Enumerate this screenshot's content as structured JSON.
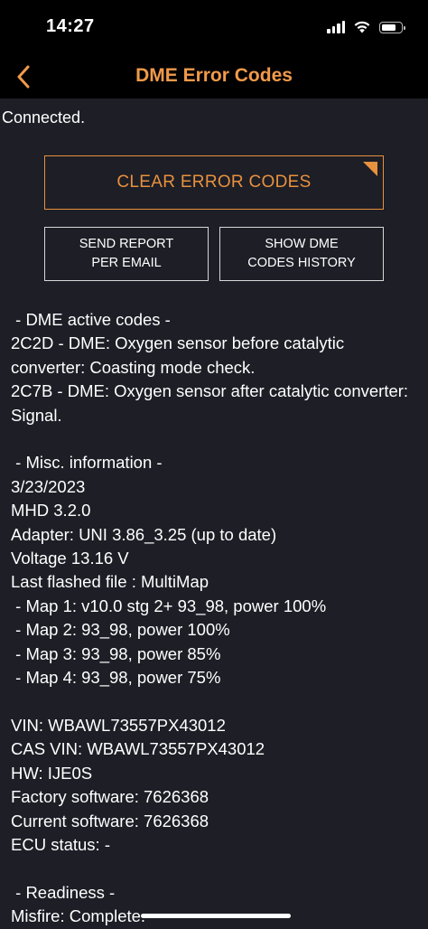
{
  "status_bar": {
    "time": "14:27",
    "signal_bars": 4,
    "battery_level": 0.75
  },
  "nav": {
    "title": "DME Error Codes",
    "back_icon": "chevron-left-icon",
    "accent_color": "#f19a4a"
  },
  "connection": {
    "status": "Connected."
  },
  "buttons": {
    "clear_codes": "CLEAR ERROR CODES",
    "send_report_line1": "SEND REPORT",
    "send_report_line2": "PER EMAIL",
    "show_history_line1": "SHOW DME",
    "show_history_line2": "CODES HISTORY"
  },
  "report_lines": [
    " - DME active codes -",
    "2C2D - DME: Oxygen sensor before catalytic converter: Coasting mode check.",
    "2C7B - DME: Oxygen sensor after catalytic converter: Signal.",
    "",
    " - Misc. information -",
    "3/23/2023",
    "MHD 3.2.0",
    "Adapter: UNI 3.86_3.25 (up to date)",
    "Voltage 13.16 V",
    "Last flashed file : MultiMap",
    " - Map 1: v10.0 stg 2+ 93_98, power 100%",
    " - Map 2: 93_98, power 100%",
    " - Map 3: 93_98, power 85%",
    " - Map 4: 93_98, power 75%",
    "",
    "VIN: WBAWL73557PX43012",
    "CAS VIN: WBAWL73557PX43012",
    "HW: IJE0S",
    "Factory software: 7626368",
    "Current software: 7626368",
    "ECU status: -",
    "",
    " - Readiness -",
    "Misfire: Complete."
  ]
}
